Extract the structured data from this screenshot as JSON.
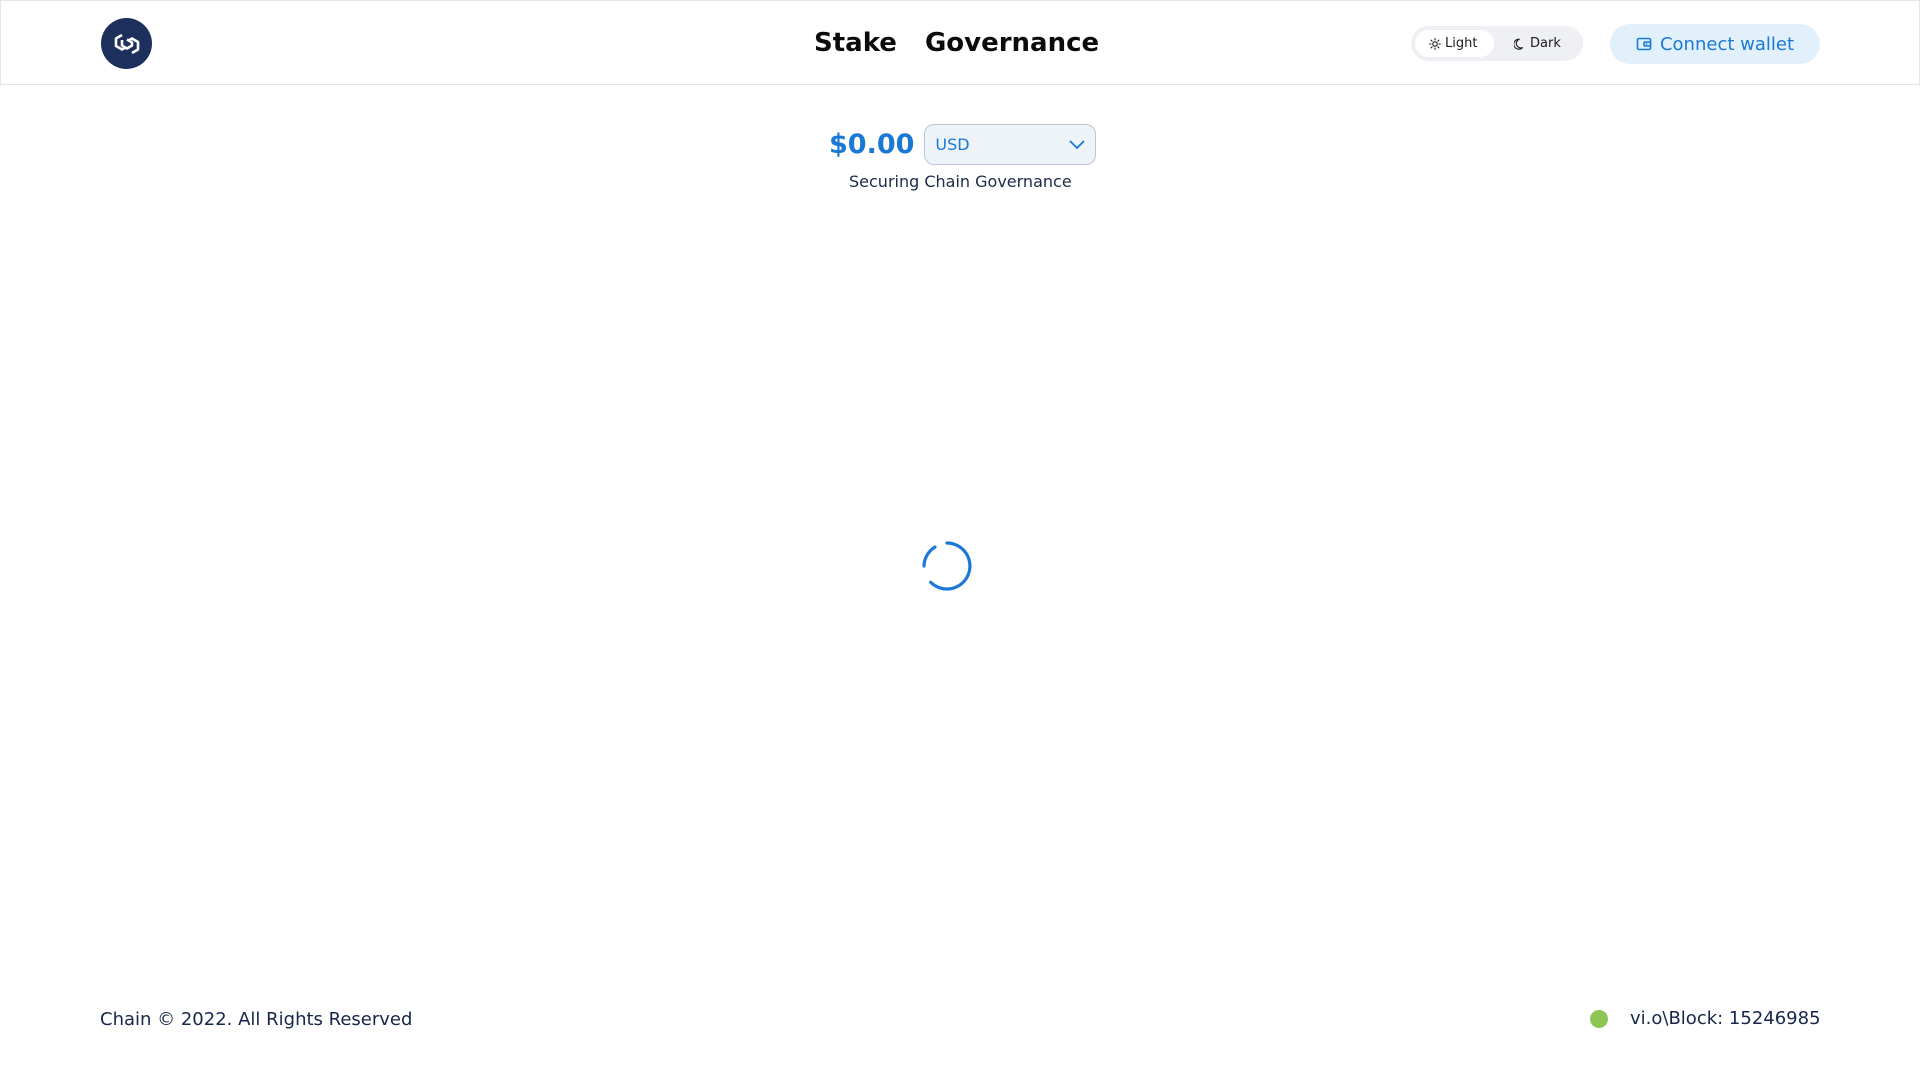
{
  "header": {
    "logo_icon": "chain-hexagon-logo-icon",
    "nav": [
      {
        "label": "Stake"
      },
      {
        "label": "Governance"
      }
    ],
    "theme": {
      "light_label": "Light",
      "dark_label": "Dark",
      "selected": "Light",
      "light_icon": "sun-icon",
      "dark_icon": "moon-icon"
    },
    "connect_wallet": {
      "label": "Connect wallet",
      "icon": "wallet-icon"
    }
  },
  "main": {
    "balance": "$0.00",
    "currency": {
      "selected": "USD",
      "icon": "chevron-down-icon"
    },
    "tagline": "Securing Chain Governance",
    "loading_icon": "spinner-icon"
  },
  "footer": {
    "copyright": "Chain © 2022. All Rights Reserved",
    "block_status": "vi.o\\Block: 15246985",
    "status_color": "#8dc653"
  },
  "colors": {
    "accent": "#1a78d6",
    "logo_bg": "#1d2f5c",
    "button_bg": "#e2f0fc"
  }
}
